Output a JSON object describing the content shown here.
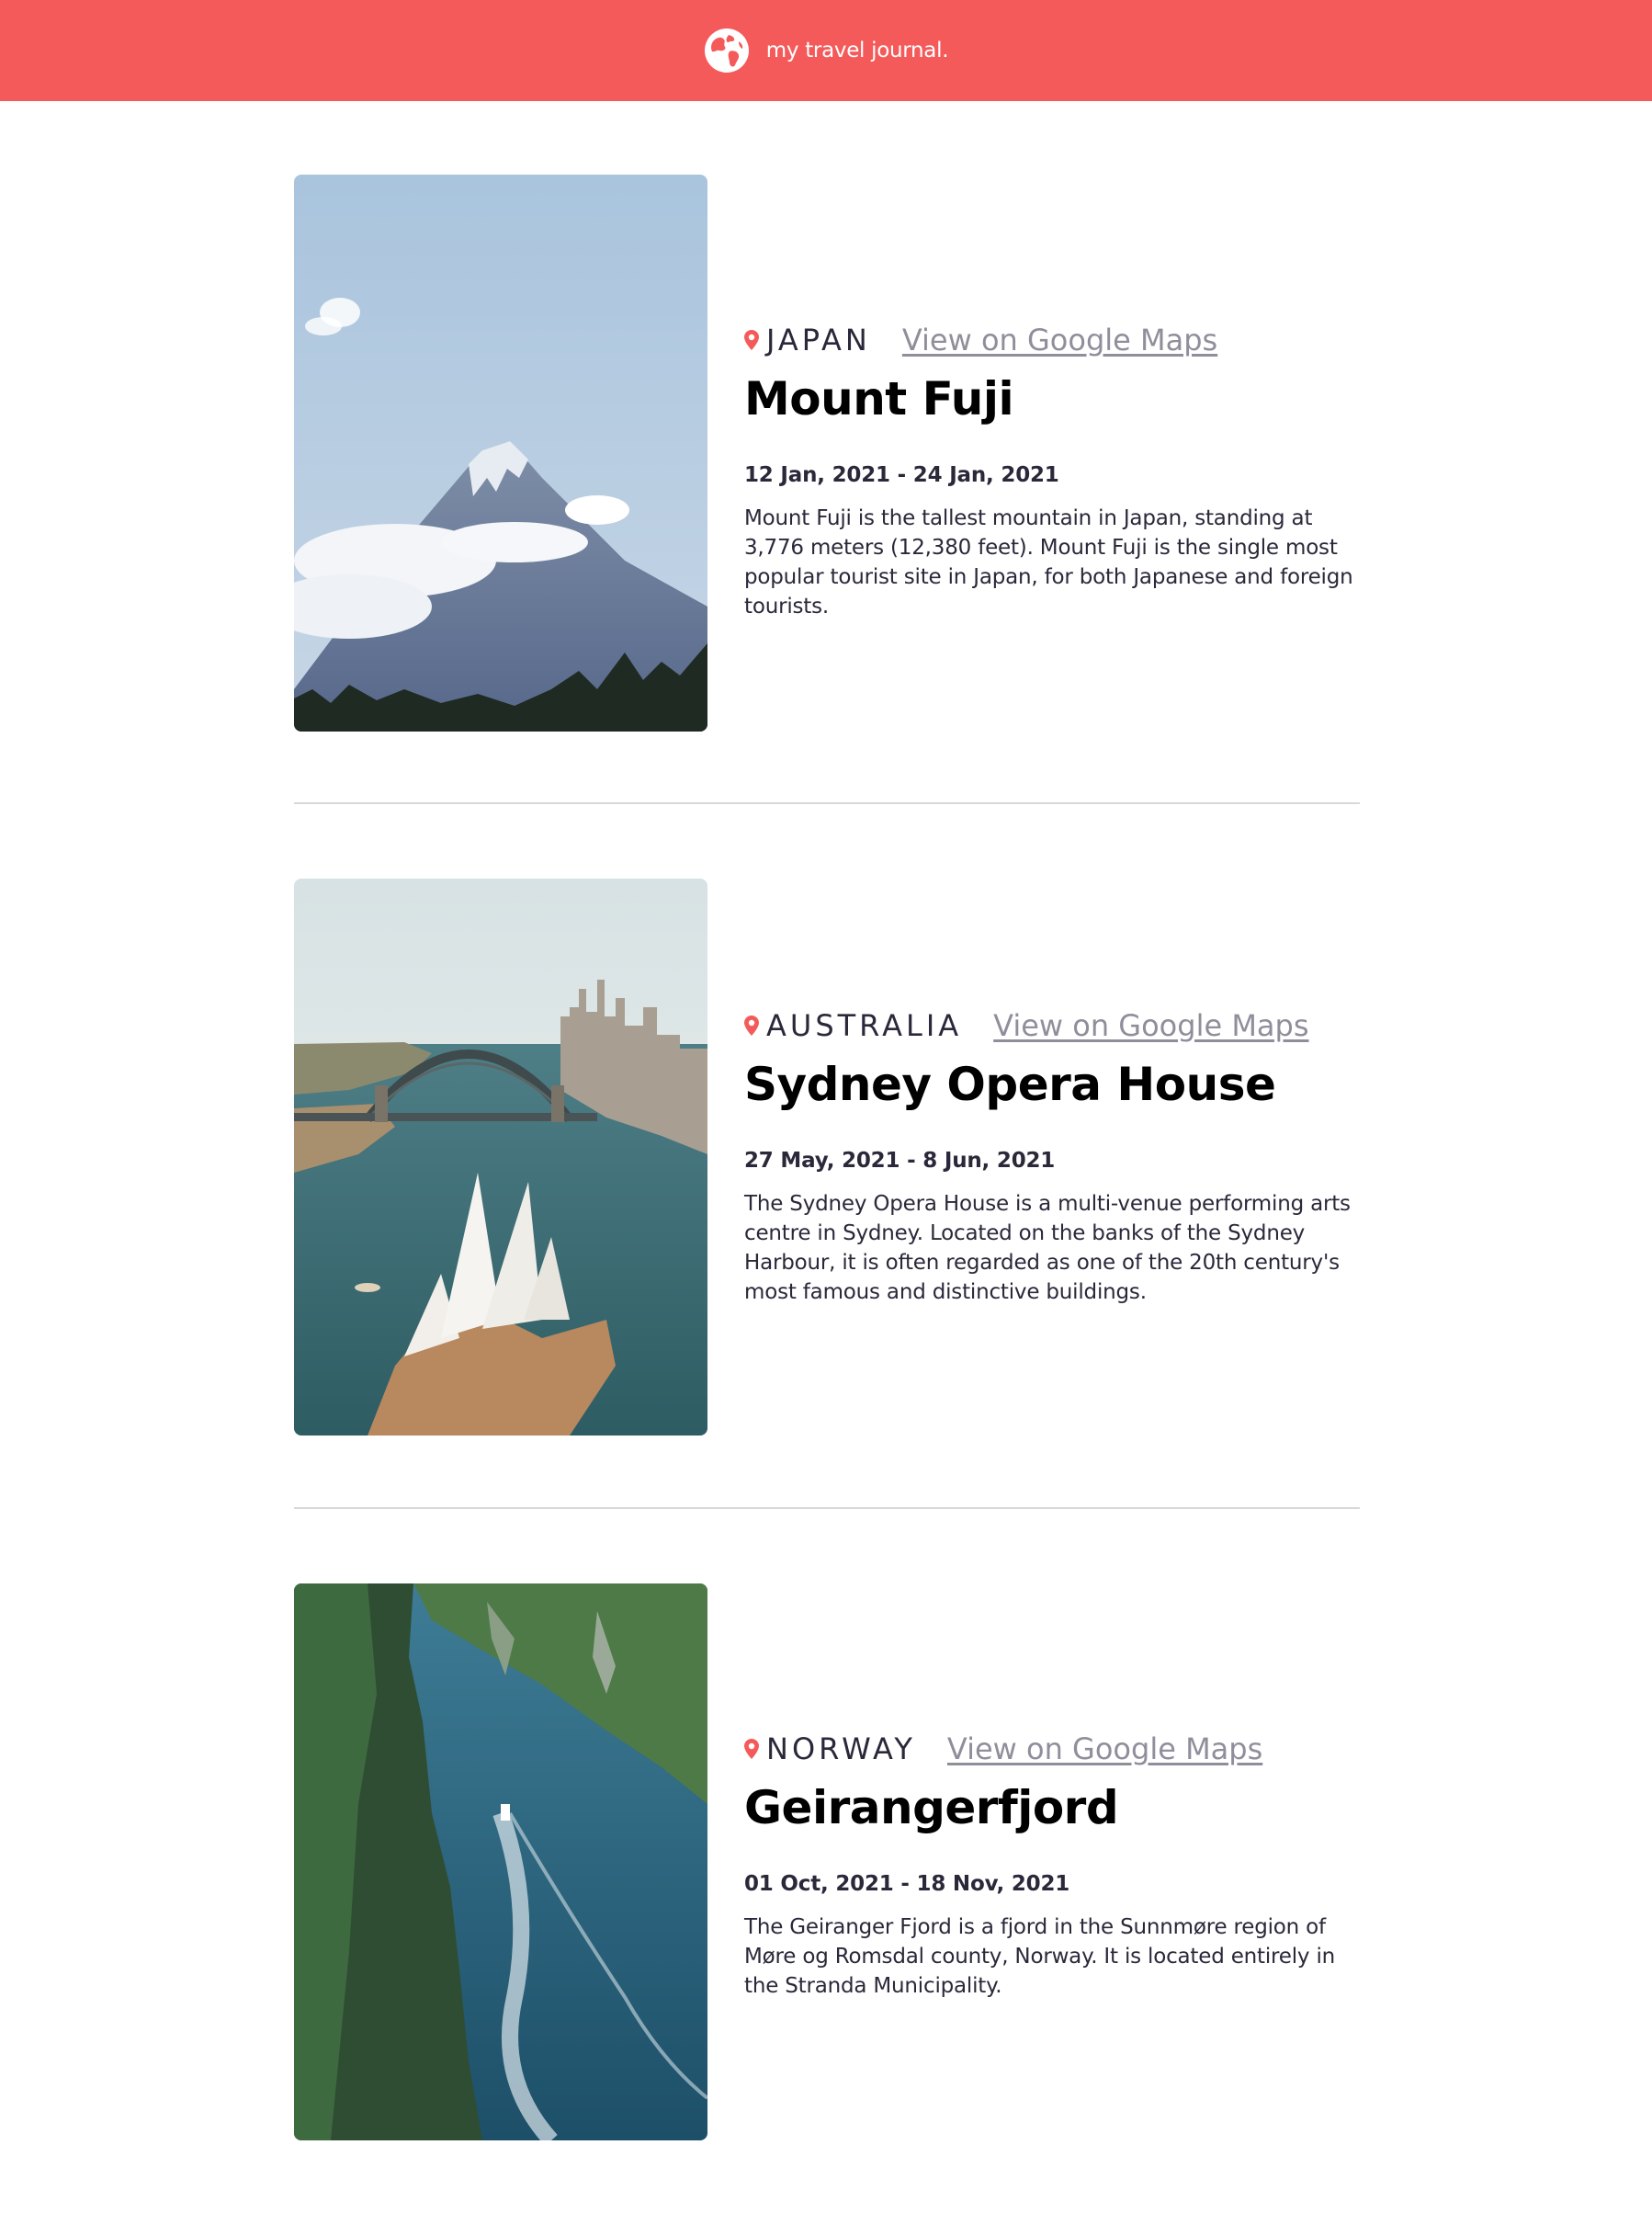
{
  "header": {
    "title": "my travel journal.",
    "icon": "globe-icon",
    "background_color": "#F55A5A"
  },
  "link_label": "View on Google Maps",
  "accent_color": "#F55A5A",
  "entries": [
    {
      "country": "JAPAN",
      "title": "Mount Fuji",
      "dates": "12 Jan, 2021 - 24 Jan, 2021",
      "description": "Mount Fuji is the tallest mountain in Japan, standing at 3,776 meters (12,380 feet). Mount Fuji is the single most popular tourist site in Japan, for both Japanese and foreign tourists."
    },
    {
      "country": "AUSTRALIA",
      "title": "Sydney Opera House",
      "dates": "27 May, 2021 - 8 Jun, 2021",
      "description": "The Sydney Opera House is a multi-venue performing arts centre in Sydney. Located on the banks of the Sydney Harbour, it is often regarded as one of the 20th century's most famous and distinctive buildings."
    },
    {
      "country": "NORWAY",
      "title": "Geirangerfjord",
      "dates": "01 Oct, 2021 - 18 Nov, 2021",
      "description": "The Geiranger Fjord is a fjord in the Sunnmøre region of Møre og Romsdal county, Norway. It is located entirely in the Stranda Municipality."
    }
  ]
}
